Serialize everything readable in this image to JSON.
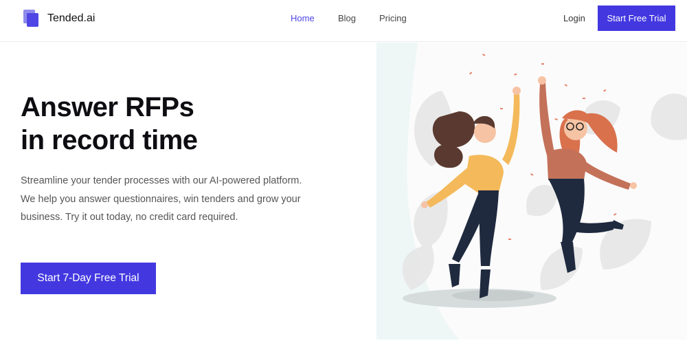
{
  "brand": {
    "name": "Tended.ai"
  },
  "nav": {
    "home": "Home",
    "blog": "Blog",
    "pricing": "Pricing",
    "login": "Login",
    "cta": "Start Free Trial"
  },
  "hero": {
    "title_line1": "Answer RFPs",
    "title_line2": "in record time",
    "subtitle": "Streamline your tender processes with our AI-powered platform. We help you answer questionnaires, win tenders and grow your business. Try it out today, no credit card required.",
    "cta": "Start 7-Day Free Trial"
  },
  "colors": {
    "accent": "#4338e0",
    "logo_light": "#8e8bea",
    "logo_dark": "#4f46e5"
  }
}
